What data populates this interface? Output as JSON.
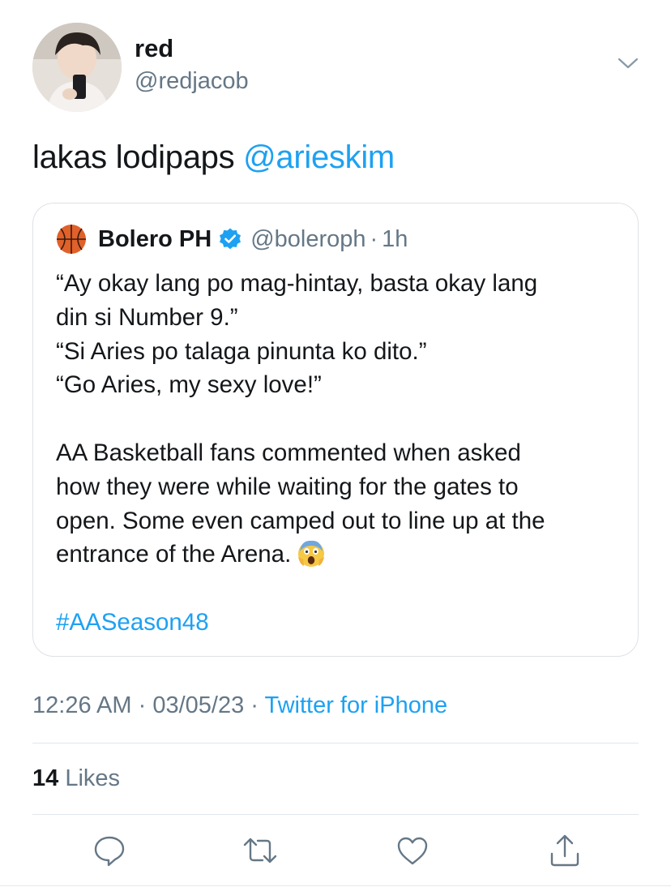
{
  "author": {
    "name": "red",
    "handle": "@redjacob"
  },
  "tweet": {
    "text": "lakas lodipaps ",
    "mention": "@arieskim"
  },
  "quoted": {
    "name": "Bolero PH",
    "handle": "@boleroph",
    "separator": "·",
    "time": "1h",
    "lines": [
      "“Ay okay lang po mag-hintay, basta okay lang",
      "din si Number 9.”",
      "“Si Aries po talaga pinunta ko dito.”",
      "“Go Aries, my sexy love!”",
      "AA Basketball fans commented when asked",
      "how they were while waiting for the gates to",
      "open. Some even camped out to line up at the",
      "entrance of the Arena."
    ],
    "hashtag": "#AASeason48"
  },
  "meta": {
    "time": "12:26 AM",
    "sep1": " · ",
    "date": "03/05/23",
    "sep2": " · ",
    "source": "Twitter for iPhone"
  },
  "stats": {
    "likes_count": "14",
    "likes_label": " Likes"
  },
  "icons": {
    "menu": "chevron-down-icon",
    "reply": "reply-icon",
    "retweet": "retweet-icon",
    "like": "heart-icon",
    "share": "share-icon",
    "verified": "verified-badge-icon",
    "emoji": "screaming-face-emoji"
  },
  "colors": {
    "accent": "#1da1f2",
    "text": "#14171a",
    "secondary": "#657786",
    "border": "#e1e8ed"
  }
}
